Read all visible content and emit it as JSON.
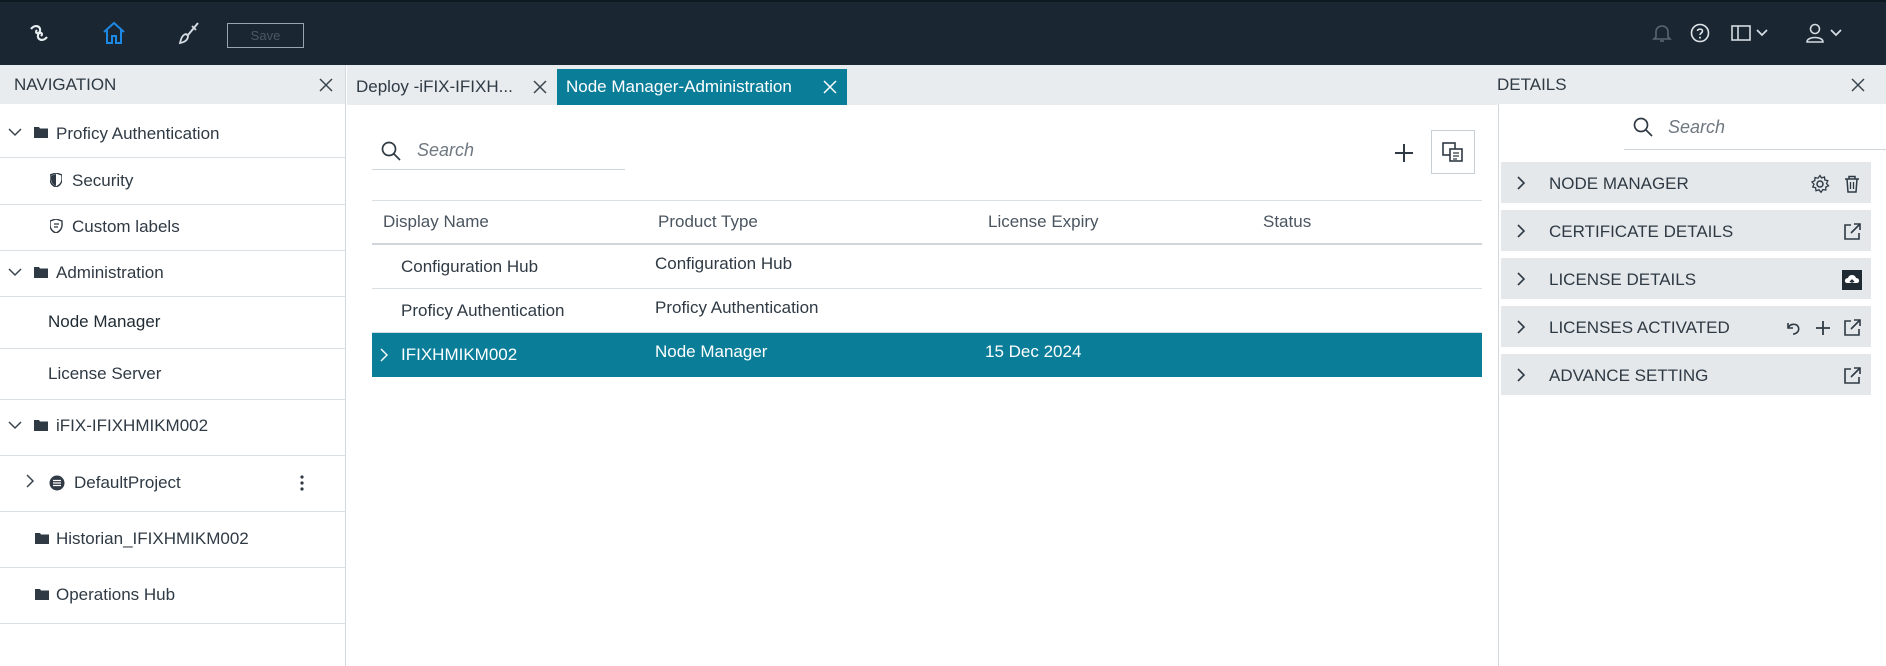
{
  "topbar": {
    "save_label": "Save"
  },
  "navigation": {
    "title": "NAVIGATION",
    "items": [
      {
        "label": "Proficy Authentication"
      },
      {
        "label": "Security"
      },
      {
        "label": "Custom labels"
      },
      {
        "label": "Administration"
      },
      {
        "label": "Node Manager"
      },
      {
        "label": "License Server"
      },
      {
        "label": "iFIX-IFIXHMIKM002"
      },
      {
        "label": "DefaultProject"
      },
      {
        "label": "Historian_IFIXHMIKM002"
      },
      {
        "label": "Operations Hub"
      }
    ]
  },
  "tabs": [
    {
      "label": "Deploy -iFIX-IFIXH..."
    },
    {
      "label": "Node Manager-Administration"
    }
  ],
  "main": {
    "search_placeholder": "Search",
    "columns": [
      "Display Name",
      "Product Type",
      "License Expiry",
      "Status"
    ],
    "rows": [
      {
        "name": "Configuration Hub",
        "type": "Configuration Hub",
        "expiry": "",
        "status": ""
      },
      {
        "name": "Proficy Authentication",
        "type": "Proficy Authentication",
        "expiry": "",
        "status": ""
      },
      {
        "name": "IFIXHMIKM002",
        "type": "Node Manager",
        "expiry": "15 Dec 2024",
        "status": ""
      }
    ]
  },
  "details": {
    "title": "DETAILS",
    "search_placeholder": "Search",
    "sections": [
      {
        "label": "NODE MANAGER"
      },
      {
        "label": "CERTIFICATE DETAILS"
      },
      {
        "label": "LICENSE DETAILS"
      },
      {
        "label": "LICENSES ACTIVATED"
      },
      {
        "label": "ADVANCE SETTING"
      }
    ]
  },
  "colors": {
    "topbar": "#1a2733",
    "accent": "#0a7d99",
    "home_icon": "#1e88e5"
  }
}
